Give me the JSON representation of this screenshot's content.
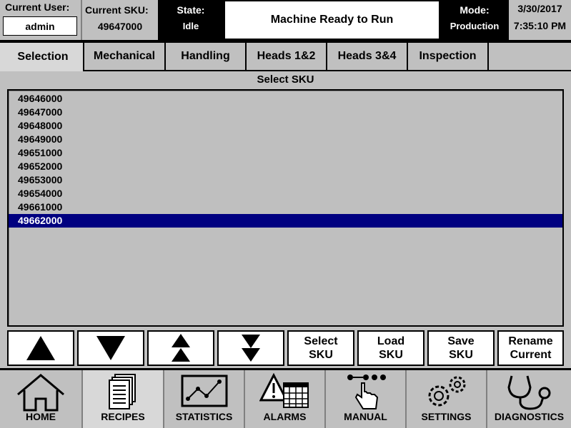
{
  "header": {
    "current_user_label": "Current User:",
    "current_user": "admin",
    "current_sku_label": "Current SKU:",
    "current_sku": "49647000",
    "state_label": "State:",
    "state": "Idle",
    "message": "Machine Ready to Run",
    "mode_label": "Mode:",
    "mode": "Production",
    "date": "3/30/2017",
    "time": "7:35:10 PM"
  },
  "tabs": [
    {
      "label": "Selection"
    },
    {
      "label": "Mechanical"
    },
    {
      "label": "Handling"
    },
    {
      "label": "Heads 1&2"
    },
    {
      "label": "Heads 3&4"
    },
    {
      "label": "Inspection"
    }
  ],
  "list": {
    "title": "Select SKU",
    "items": [
      "49646000",
      "49647000",
      "49648000",
      "49649000",
      "49651000",
      "49652000",
      "49653000",
      "49654000",
      "49661000",
      "49662000"
    ],
    "selected": "49662000"
  },
  "buttons": {
    "up": "up-arrow",
    "down": "down-arrow",
    "page_up": "page-up-arrow",
    "page_down": "page-down-arrow",
    "select_sku": "Select\nSKU",
    "load_sku": "Load\nSKU",
    "save_sku": "Save\nSKU",
    "rename_current": "Rename\nCurrent"
  },
  "nav": [
    {
      "label": "HOME",
      "icon": "home-icon"
    },
    {
      "label": "RECIPES",
      "icon": "recipes-icon"
    },
    {
      "label": "STATISTICS",
      "icon": "statistics-icon"
    },
    {
      "label": "ALARMS",
      "icon": "alarms-icon"
    },
    {
      "label": "MANUAL",
      "icon": "manual-icon"
    },
    {
      "label": "SETTINGS",
      "icon": "settings-icon"
    },
    {
      "label": "DIAGNOSTICS",
      "icon": "diagnostics-icon"
    }
  ],
  "colors": {
    "selected_row": "#000080",
    "background": "#c0c0c0"
  }
}
